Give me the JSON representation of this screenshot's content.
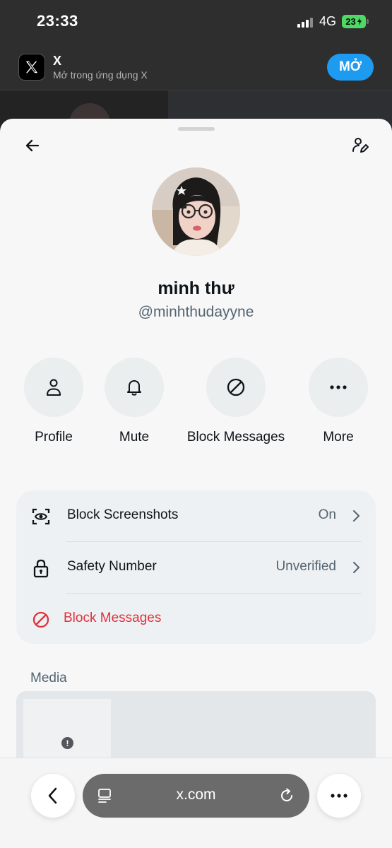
{
  "status_bar": {
    "time": "23:33",
    "network": "4G",
    "battery": "23"
  },
  "app_banner": {
    "title": "X",
    "subtitle": "Mở trong ứng dụng X",
    "open_label": "MỞ"
  },
  "profile": {
    "name": "minh thư",
    "handle": "@minhthudayyne"
  },
  "actions": [
    {
      "label": "Profile",
      "icon": "person-icon"
    },
    {
      "label": "Mute",
      "icon": "bell-icon"
    },
    {
      "label": "Block Messages",
      "icon": "block-icon"
    },
    {
      "label": "More",
      "icon": "more-icon"
    }
  ],
  "settings": {
    "rows": [
      {
        "label": "Block Screenshots",
        "value": "On",
        "icon": "screenshot-eye-icon"
      },
      {
        "label": "Safety Number",
        "value": "Unverified",
        "icon": "lock-icon"
      },
      {
        "label": "Block Messages",
        "icon": "block-icon",
        "color": "#e0313b"
      }
    ]
  },
  "media": {
    "title": "Media"
  },
  "browser": {
    "url": "x.com"
  },
  "colors": {
    "accent": "#1d9bf0",
    "danger": "#e0313b",
    "muted": "#536471"
  }
}
